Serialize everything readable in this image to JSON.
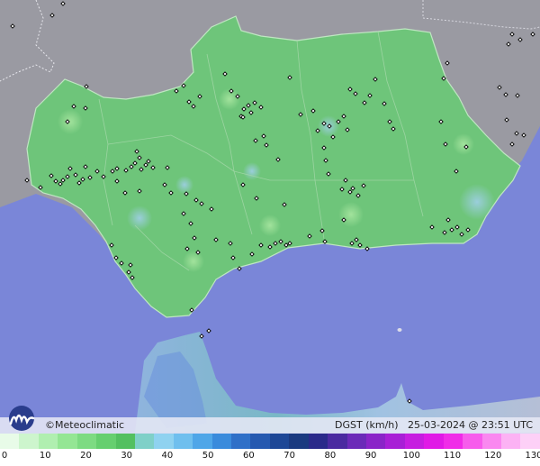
{
  "brand": {
    "copyright_symbol": "©",
    "name": "Meteoclimatic"
  },
  "meta": {
    "variable": "DGST",
    "unit": "(km/h)",
    "date": "25-03-2024",
    "at": "@",
    "time": "23:51",
    "tz": "UTC"
  },
  "scale": {
    "labels": [
      "0",
      "10",
      "20",
      "30",
      "40",
      "50",
      "60",
      "70",
      "80",
      "90",
      "100",
      "110",
      "120",
      "130"
    ],
    "colors": [
      "#e8fbe8",
      "#cdf5cd",
      "#b0efb0",
      "#94e694",
      "#7ddb82",
      "#66cf6f",
      "#53c060",
      "#7fd0c8",
      "#8fd2f0",
      "#6fbfee",
      "#4fa6e8",
      "#3a8bdc",
      "#2f70c8",
      "#2559b0",
      "#1d4796",
      "#1a3a80",
      "#2a2a8a",
      "#4a2aa0",
      "#6b2ab8",
      "#8a24c8",
      "#a81fd6",
      "#c61ee0",
      "#e01ae6",
      "#f02ce8",
      "#f75cec",
      "#fa88f0",
      "#fcb2f4",
      "#fdd0f7"
    ]
  },
  "stations": [
    [
      14,
      29
    ],
    [
      58,
      17
    ],
    [
      70,
      4
    ],
    [
      75,
      135
    ],
    [
      82,
      118
    ],
    [
      95,
      120
    ],
    [
      96,
      96
    ],
    [
      30,
      200
    ],
    [
      45,
      208
    ],
    [
      57,
      195
    ],
    [
      62,
      201
    ],
    [
      67,
      204
    ],
    [
      70,
      200
    ],
    [
      75,
      196
    ],
    [
      78,
      187
    ],
    [
      84,
      194
    ],
    [
      88,
      203
    ],
    [
      92,
      199
    ],
    [
      95,
      185
    ],
    [
      100,
      197
    ],
    [
      108,
      190
    ],
    [
      115,
      196
    ],
    [
      125,
      190
    ],
    [
      130,
      187
    ],
    [
      140,
      189
    ],
    [
      146,
      185
    ],
    [
      150,
      181
    ],
    [
      155,
      175
    ],
    [
      152,
      168
    ],
    [
      157,
      188
    ],
    [
      162,
      183
    ],
    [
      165,
      179
    ],
    [
      170,
      186
    ],
    [
      186,
      186
    ],
    [
      183,
      205
    ],
    [
      196,
      101
    ],
    [
      204,
      95
    ],
    [
      210,
      113
    ],
    [
      215,
      118
    ],
    [
      222,
      107
    ],
    [
      250,
      82
    ],
    [
      257,
      101
    ],
    [
      264,
      107
    ],
    [
      268,
      129
    ],
    [
      271,
      121
    ],
    [
      276,
      117
    ],
    [
      279,
      125
    ],
    [
      283,
      114
    ],
    [
      290,
      119
    ],
    [
      270,
      130
    ],
    [
      284,
      156
    ],
    [
      293,
      151
    ],
    [
      296,
      161
    ],
    [
      309,
      177
    ],
    [
      322,
      86
    ],
    [
      334,
      127
    ],
    [
      348,
      123
    ],
    [
      353,
      145
    ],
    [
      360,
      137
    ],
    [
      366,
      140
    ],
    [
      370,
      152
    ],
    [
      376,
      135
    ],
    [
      382,
      129
    ],
    [
      386,
      144
    ],
    [
      389,
      99
    ],
    [
      395,
      104
    ],
    [
      405,
      114
    ],
    [
      411,
      106
    ],
    [
      417,
      88
    ],
    [
      427,
      115
    ],
    [
      433,
      135
    ],
    [
      437,
      143
    ],
    [
      493,
      87
    ],
    [
      490,
      135
    ],
    [
      495,
      160
    ],
    [
      507,
      190
    ],
    [
      518,
      163
    ],
    [
      360,
      164
    ],
    [
      362,
      178
    ],
    [
      365,
      193
    ],
    [
      380,
      210
    ],
    [
      384,
      200
    ],
    [
      389,
      213
    ],
    [
      392,
      209
    ],
    [
      398,
      217
    ],
    [
      404,
      206
    ],
    [
      270,
      205
    ],
    [
      285,
      220
    ],
    [
      316,
      227
    ],
    [
      130,
      201
    ],
    [
      139,
      214
    ],
    [
      155,
      212
    ],
    [
      190,
      214
    ],
    [
      204,
      237
    ],
    [
      207,
      215
    ],
    [
      218,
      222
    ],
    [
      224,
      226
    ],
    [
      235,
      232
    ],
    [
      212,
      248
    ],
    [
      216,
      264
    ],
    [
      220,
      280
    ],
    [
      208,
      276
    ],
    [
      240,
      266
    ],
    [
      256,
      270
    ],
    [
      259,
      286
    ],
    [
      266,
      298
    ],
    [
      280,
      282
    ],
    [
      290,
      272
    ],
    [
      300,
      274
    ],
    [
      306,
      270
    ],
    [
      312,
      268
    ],
    [
      318,
      272
    ],
    [
      322,
      270
    ],
    [
      344,
      262
    ],
    [
      358,
      256
    ],
    [
      361,
      268
    ],
    [
      382,
      244
    ],
    [
      391,
      270
    ],
    [
      396,
      266
    ],
    [
      400,
      272
    ],
    [
      408,
      276
    ],
    [
      480,
      252
    ],
    [
      494,
      258
    ],
    [
      498,
      244
    ],
    [
      502,
      255
    ],
    [
      508,
      252
    ],
    [
      513,
      260
    ],
    [
      520,
      255
    ],
    [
      124,
      272
    ],
    [
      129,
      286
    ],
    [
      135,
      292
    ],
    [
      143,
      302
    ],
    [
      147,
      308
    ],
    [
      145,
      294
    ],
    [
      213,
      344
    ],
    [
      224,
      373
    ],
    [
      232,
      367
    ],
    [
      455,
      445
    ],
    [
      569,
      38
    ],
    [
      565,
      49
    ],
    [
      578,
      44
    ],
    [
      592,
      38
    ],
    [
      497,
      70
    ],
    [
      555,
      97
    ],
    [
      562,
      105
    ],
    [
      575,
      106
    ],
    [
      563,
      133
    ],
    [
      569,
      160
    ],
    [
      574,
      148
    ],
    [
      582,
      150
    ]
  ]
}
